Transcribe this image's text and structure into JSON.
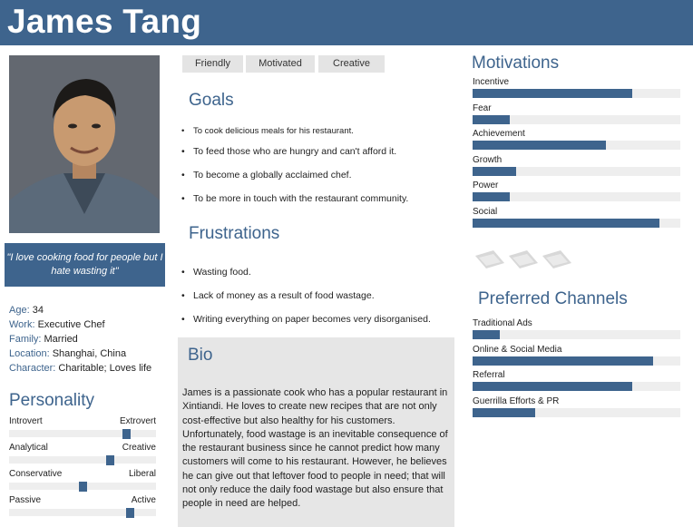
{
  "persona": {
    "name": "James Tang",
    "quote": "\"I love cooking food for people but I hate wasting it\"",
    "details": [
      {
        "key": "Age:",
        "value": "34"
      },
      {
        "key": "Work:",
        "value": "Executive Chef"
      },
      {
        "key": "Family:",
        "value": "Married"
      },
      {
        "key": "Location:",
        "value": "Shanghai, China"
      },
      {
        "key": "Character:",
        "value": "Charitable; Loves life"
      }
    ]
  },
  "personality": {
    "title": "Personality",
    "traits": [
      {
        "left": "Introvert",
        "right": "Extrovert",
        "level": 0.82
      },
      {
        "left": "Analytical",
        "right": "Creative",
        "level": 0.7
      },
      {
        "left": "Conservative",
        "right": "Liberal",
        "level": 0.5
      },
      {
        "left": "Passive",
        "right": "Active",
        "level": 0.84
      }
    ]
  },
  "tags": [
    "Friendly",
    "Motivated",
    "Creative"
  ],
  "goals": {
    "title": "Goals",
    "items": [
      "To cook delicious meals for his restaurant.",
      "To feed those who are hungry and can't afford it.",
      "To become a globally acclaimed chef.",
      "To be more in touch with the restaurant community."
    ]
  },
  "frustrations": {
    "title": "Frustrations",
    "items": [
      "Wasting food.",
      "Lack of money as a result of food wastage.",
      "Writing everything on paper becomes very disorganised."
    ]
  },
  "bio": {
    "title": "Bio",
    "text": "James is a passionate cook who has a popular restaurant in Xintiandi. He loves to create new recipes that are not only cost-effective but also healthy for his customers. Unfortunately, food wastage is an inevitable consequence of the restaurant business since he cannot predict how many customers will come to his restaurant. However, he believes he can give out that leftover food to people in need; that will not only reduce the daily food wastage but also ensure that people in need are helped."
  },
  "motivations": {
    "title": "Motivations",
    "items": [
      {
        "label": "Incentive",
        "value": 0.77
      },
      {
        "label": "Fear",
        "value": 0.18
      },
      {
        "label": "Achievement",
        "value": 0.64
      },
      {
        "label": "Growth",
        "value": 0.21
      },
      {
        "label": "Power",
        "value": 0.18
      },
      {
        "label": "Social",
        "value": 0.9
      }
    ]
  },
  "brands": [
    "brand-logo-icon",
    "brand-logo-icon",
    "brand-logo-icon"
  ],
  "channels": {
    "title": "Preferred Channels",
    "items": [
      {
        "label": "Traditional Ads",
        "value": 0.13
      },
      {
        "label": "Online & Social Media",
        "value": 0.87
      },
      {
        "label": "Referral",
        "value": 0.77
      },
      {
        "label": "Guerrilla Efforts & PR",
        "value": 0.3
      }
    ]
  },
  "colors": {
    "accent": "#3e648d",
    "track": "#eeeeee",
    "panel": "#e6e6e6"
  }
}
